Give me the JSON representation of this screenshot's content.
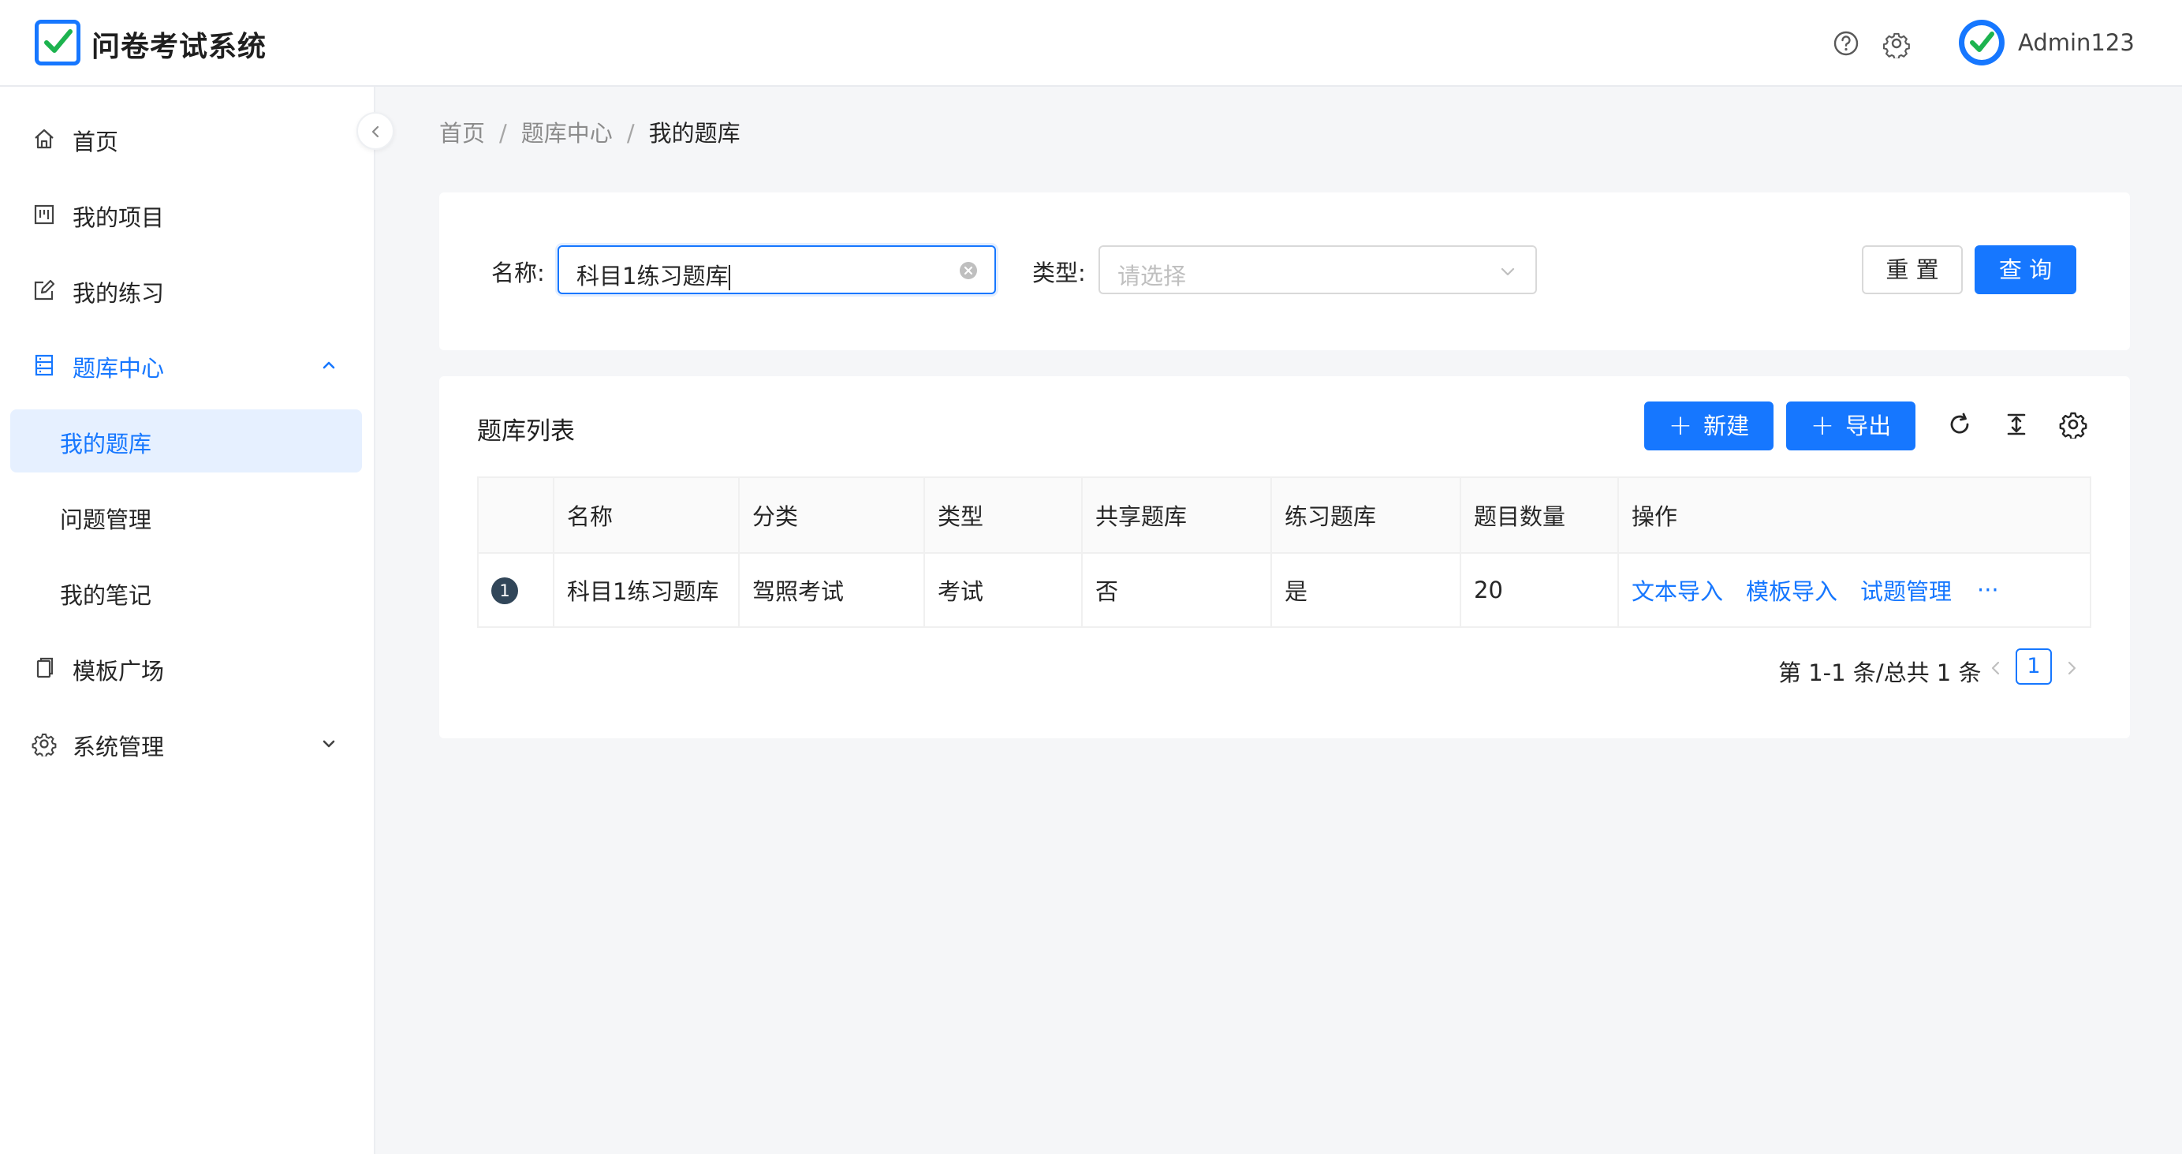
{
  "header": {
    "app_title": "问卷考试系统",
    "username": "Admin123",
    "icons": [
      "help-icon",
      "settings-icon"
    ]
  },
  "sidebar": {
    "items": [
      {
        "label": "首页",
        "icon": "home-icon"
      },
      {
        "label": "我的项目",
        "icon": "project-icon"
      },
      {
        "label": "我的练习",
        "icon": "edit-icon"
      },
      {
        "label": "题库中心",
        "icon": "database-icon",
        "expanded": true,
        "children": [
          {
            "label": "我的题库",
            "selected": true
          },
          {
            "label": "问题管理"
          },
          {
            "label": "我的笔记"
          }
        ]
      },
      {
        "label": "模板广场",
        "icon": "copy-icon"
      },
      {
        "label": "系统管理",
        "icon": "gear-icon",
        "expanded": false
      }
    ]
  },
  "breadcrumb": [
    "首页",
    "题库中心",
    "我的题库"
  ],
  "search": {
    "name_label": "名称",
    "name_value": "科目1练习题库",
    "type_label": "类型",
    "type_placeholder": "请选择",
    "reset_label": "重 置",
    "query_label": "查 询"
  },
  "list": {
    "title": "题库列表",
    "new_label": "新建",
    "export_label": "导出",
    "columns": [
      "",
      "名称",
      "分类",
      "类型",
      "共享题库",
      "练习题库",
      "题目数量",
      "操作"
    ],
    "rows": [
      {
        "index": "1",
        "name": "科目1练习题库",
        "category": "驾照考试",
        "type": "考试",
        "shared": "否",
        "practice": "是",
        "count": "20",
        "actions": [
          "文本导入",
          "模板导入",
          "试题管理",
          "···"
        ]
      }
    ]
  },
  "pagination": {
    "summary": "第 1-1 条/总共 1 条",
    "current_page": "1"
  },
  "colors": {
    "primary": "#1677ff",
    "selected_bg": "#e6f0ff",
    "page_bg": "#f5f6f8"
  }
}
